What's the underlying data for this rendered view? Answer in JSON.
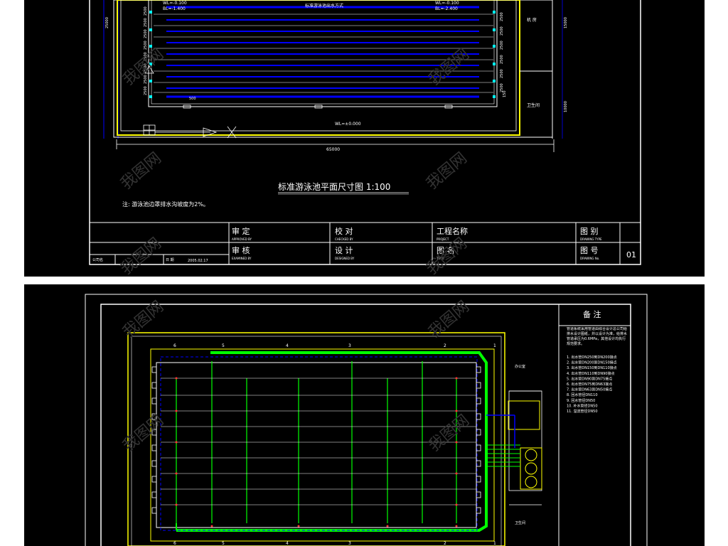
{
  "top_sheet": {
    "lane_markers": {
      "wl_left": "WL=-0.100",
      "bl_left": "BL=-1.400",
      "wl_right": "WL=-0.100",
      "bl_right": "BL=-2.400",
      "lane_label": "标准游泳池出水方式"
    },
    "left_dims": [
      "2500",
      "2500",
      "2500",
      "2500",
      "2500",
      "2500",
      "2500",
      "2500"
    ],
    "left_total": "25000",
    "right_dims": [
      "2500",
      "2500",
      "2500",
      "2500",
      "2500",
      "2500"
    ],
    "right_small": "150",
    "bottom_level": "WL=±0.000",
    "inner_dim": "500",
    "overall_dim": "65000",
    "room_1": "机 房",
    "room_2": "卫生间",
    "side_dim_1": "15000",
    "side_dim_2": "10000",
    "drawing_title": "标准游泳池平面尺寸图   1:100",
    "note": "注: 游泳池边罩排水沟坡度为2%。",
    "title_block": {
      "approved": "审    定",
      "approved_en": "APPROVED BY",
      "checked_by": "审    核",
      "checked_en": "EXAMINED BY",
      "checked": "校    对",
      "checked2_en": "CHECKED BY",
      "designed": "设    计",
      "designed_en": "DESIGNED BY",
      "project": "工程名称",
      "project_en": "PROJECT",
      "drawing_name": "图    名",
      "drawing_name_en": "TITLE",
      "type": "图    别",
      "type_en": "DRAWING TYPE",
      "number": "图    号",
      "number_en": "DRAWING No.",
      "number_value": "01",
      "date_label": "日    期",
      "date_value": "2005.02.17",
      "company": "公司名"
    }
  },
  "bottom_sheet": {
    "notes_title": "备  注",
    "notes_intro": "管道系统采用管道由综合设计总公司给排水设计图纸，并以设计为准，给排水管道承压为0.6MPa，其他设计均执行规范要求。",
    "notes_items": [
      "1. 出水管DN250到DN200接点",
      "2. 出水管DN200到DN150接点",
      "3. 出水管DN150到DN110接点",
      "4. 出水管DN110到DN90接点",
      "5. 出水管DN90到DN75接点",
      "6. 出水管DN75到DN63接点",
      "7. 出水管DN63到DN50接点",
      "8. 回水管径DN110",
      "9. 回水管径DN50",
      "10. 补水管径DN50",
      "11. 溢流管径DN50"
    ],
    "room_office": "办公室",
    "room_toilet": "卫生间",
    "grid_top": [
      "6",
      "5",
      "4",
      "3",
      "2",
      "1"
    ],
    "grid_bottom": [
      "6",
      "5",
      "4",
      "3",
      "2",
      "1"
    ]
  },
  "watermark": "我图网",
  "colors": {
    "background": "#000000",
    "pool_lane": "#0000ff",
    "pool_outline": "#ffff00",
    "pipe_green": "#00ff00",
    "text": "#ffffff",
    "cyan": "#00ffff"
  }
}
